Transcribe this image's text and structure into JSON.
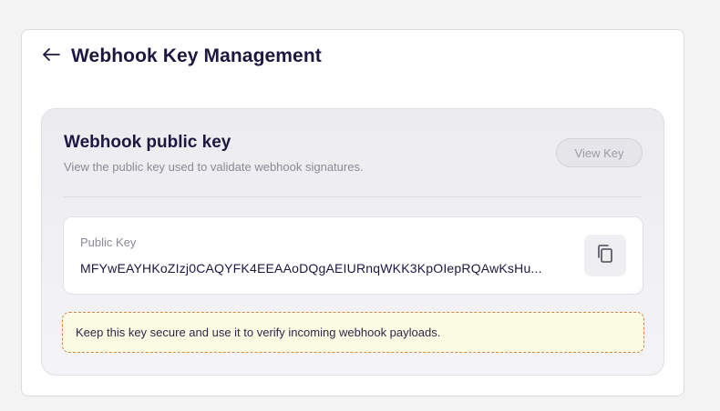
{
  "header": {
    "title": "Webhook Key Management",
    "back_icon": "arrow-left-icon"
  },
  "card": {
    "title": "Webhook public key",
    "subtitle": "View the public key used to validate webhook signatures.",
    "view_key_label": "View Key"
  },
  "key": {
    "label": "Public Key",
    "value": "MFYwEAYHKoZIzj0CAQYFK4EEAAoDQgAEIURnqWKK3KpOIepRQAwKsHu...",
    "copy_icon": "copy-icon"
  },
  "notice": {
    "text": "Keep this key secure and use it to verify incoming webhook payloads.",
    "border_color": "#d4864a",
    "background": "#fbfbe4"
  }
}
